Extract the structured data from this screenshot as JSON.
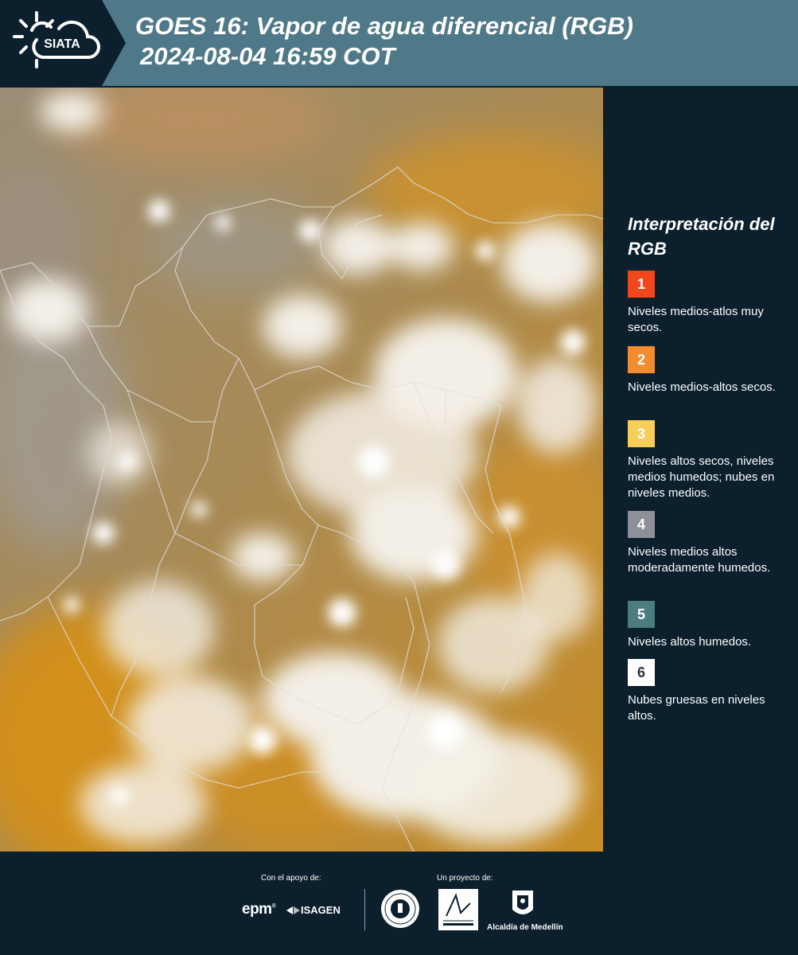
{
  "header": {
    "logo_text": "SIATA",
    "title_line1": "GOES 16: Vapor de agua diferencial (RGB)",
    "title_line2": "2024-08-04 16:59 COT"
  },
  "legend": {
    "title": "Interpretación del RGB",
    "items": [
      {
        "number": "1",
        "color": "#f2471c",
        "label": "Niveles medios-atlos muy secos."
      },
      {
        "number": "2",
        "color": "#f28c2f",
        "label": "Niveles medios-altos secos."
      },
      {
        "number": "3",
        "color": "#f7ce58",
        "label": "Niveles altos secos, niveles medios humedos; nubes en niveles medios."
      },
      {
        "number": "4",
        "color": "#8f8f9a",
        "label": "Niveles medios altos moderadamente humedos."
      },
      {
        "number": "5",
        "color": "#4d7c80",
        "label": "Niveles altos humedos."
      },
      {
        "number": "6",
        "color": "#ffffff",
        "label": "Nubes gruesas en niveles altos."
      }
    ]
  },
  "footer": {
    "support_label": "Con el apoyo de:",
    "project_label": "Un proyecto de:",
    "epm_logo": "epm",
    "isagen_logo": "ISAGEN",
    "alcaldia_label": "Alcaldía de Medellín"
  }
}
